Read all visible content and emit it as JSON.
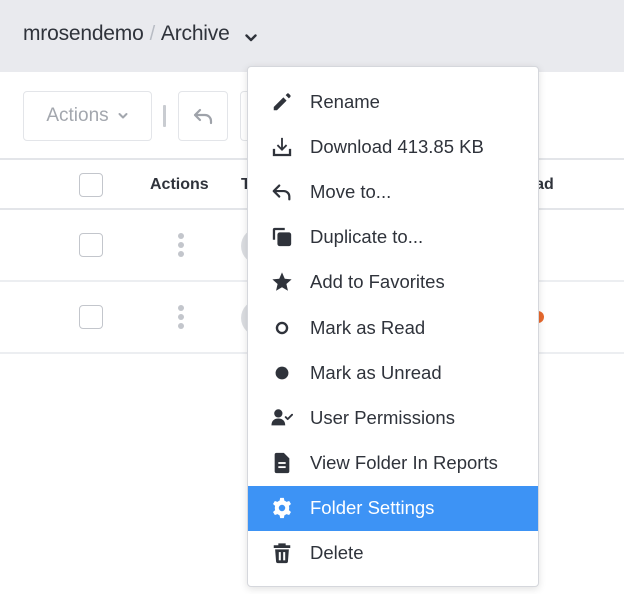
{
  "breadcrumb": {
    "user": "mrosendemo",
    "separator": "/",
    "folder": "Archive",
    "dropdown_icon": "chevron-down-icon"
  },
  "toolbar": {
    "actions_label": "Actions",
    "actions_icon": "chevron-down-icon",
    "undo_icon": "reply-arrow-icon"
  },
  "table": {
    "headers": {
      "actions": "Actions",
      "title_partial": "T",
      "unread_partial": "read"
    },
    "rows": [
      {
        "unread": false
      },
      {
        "unread": true
      }
    ],
    "unread_color": "#e8692d"
  },
  "context_menu": {
    "items": [
      {
        "label": "Rename",
        "icon": "pencil-icon"
      },
      {
        "label": "Download 413.85 KB",
        "icon": "download-icon"
      },
      {
        "label": "Move to...",
        "icon": "reply-arrow-icon"
      },
      {
        "label": "Duplicate to...",
        "icon": "duplicate-icon"
      },
      {
        "label": "Add to Favorites",
        "icon": "star-icon"
      },
      {
        "label": "Mark as Read",
        "icon": "circle-outline-icon"
      },
      {
        "label": "Mark as Unread",
        "icon": "circle-filled-icon"
      },
      {
        "label": "User Permissions",
        "icon": "user-check-icon"
      },
      {
        "label": "View Folder In Reports",
        "icon": "file-text-icon"
      },
      {
        "label": "Folder Settings",
        "icon": "gear-icon",
        "active": true
      },
      {
        "label": "Delete",
        "icon": "trash-icon"
      }
    ],
    "highlight_color": "#3d93f5"
  }
}
